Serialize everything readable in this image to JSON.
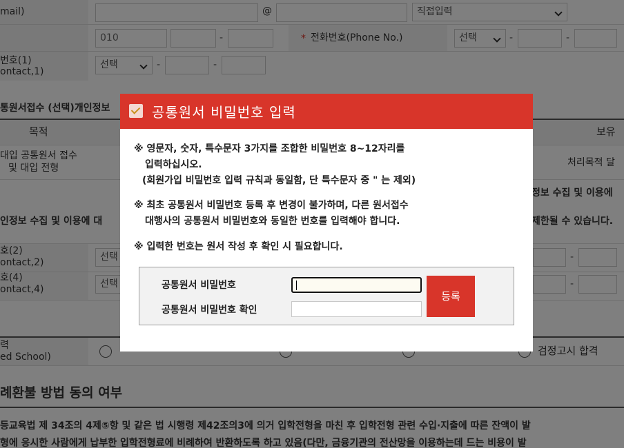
{
  "form": {
    "email_label": "mail)",
    "email_at": "@",
    "email_domain_select": "직접입력",
    "phone_prefix": "010",
    "dash": "-",
    "required_mark": "*",
    "phone_label": "전화번호(Phone No.)",
    "phone_select": "선택",
    "contact1_label_line1": "번호(1)",
    "contact1_label_line2": "ontact,1)",
    "contact1_select": "선택",
    "consent_section_title": "통원서접수 (선택)개인정보",
    "table_header_purpose": "목적",
    "table_header_retention": "보유",
    "table_row_purpose_line1": "대입 공통원서 접수",
    "table_row_purpose_line2": "및 대입 전형",
    "table_row_retention": "처리목적 달",
    "consent_right_fragment": "정보 수집 및 이용에",
    "consent_left_fragment": "인정보 수집 및 이용에 대",
    "consent_limit_fragment": "제한될 수 있습니다.",
    "contact2_label_line1": "호(2)",
    "contact2_label_line2": "ontact,2)",
    "contact2_select": "선택",
    "contact4_label_line1": "호(4)",
    "contact4_label_line2": "ontact,4)",
    "contact4_select": "선택",
    "education_label_line1": "력",
    "education_label_line2": "ed School)",
    "education_option4": "검정고시 합격",
    "refund_heading": "례환불 방법 동의 여부",
    "refund_text_line1": "등교육법 제 34조의 4제⑤항 및 같은 법 시행령 제42조의3에 의거 입학전형을 마친 후 입학전형 관련 수입·지출에 따른 잔액이 발",
    "refund_text_line2": "형에 응시한 사람에게 납부한 입학전형료에 비례하여 반환하도록 하고 있음(다만, 금융기관의 전산망을 이용하는데 드는 비용이 발"
  },
  "modal": {
    "title": "공통원서 비밀번호 입력",
    "note1_line1": "※ 영문자, 숫자, 특수문자 3가지를 조합한 비밀번호 8~12자리를",
    "note1_line2": "입력하십시오.",
    "note1_line3": "(회원가입 비밀번호 입력 규칙과 동일함, 단 특수문자 중 \" 는 제외)",
    "note2_line1": "※ 최초 공통원서 비밀번호 등록 후 변경이 불가하며, 다른 원서접수",
    "note2_line2": "대행사의 공통원서 비밀번호와 동일한 번호를 입력해야 합니다.",
    "note3": "※ 입력한 번호는 원서 작성 후 확인 시 필요합니다.",
    "password_label": "공통원서 비밀번호",
    "password_confirm_label": "공통원서 비밀번호 확인",
    "register_button": "등록"
  },
  "colors": {
    "accent": "#d8352a",
    "overlay": "rgba(0,0,0,0.5)"
  },
  "icons": {
    "modal_header_icon": "checkbox-checked-icon",
    "select_arrow": "chevron-down-icon"
  }
}
